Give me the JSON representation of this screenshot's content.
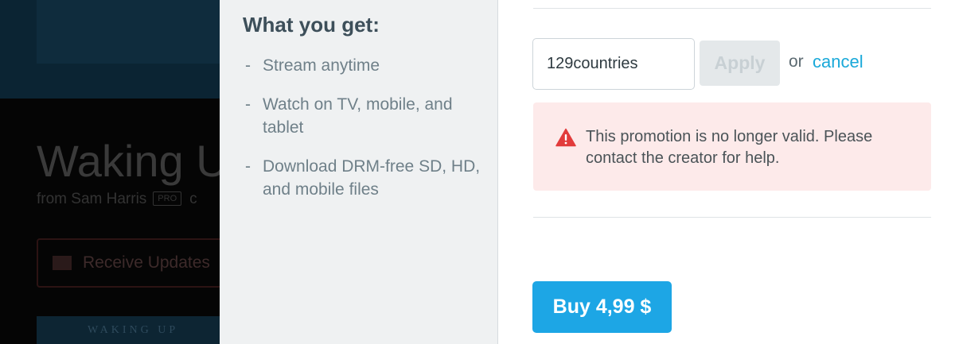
{
  "background": {
    "title": "Waking U",
    "byline_prefix": "from Sam Harris",
    "pro_badge": "PRO",
    "byline_suffix": "c",
    "receive_updates_label": "Receive Updates",
    "thumbnail_text": "WAKING UP"
  },
  "features": {
    "title": "What you get:",
    "dash": "-",
    "items": [
      "Stream anytime",
      "Watch on TV, mobile, and tablet",
      "Download DRM-free SD, HD, and mobile files"
    ]
  },
  "promo": {
    "code_value": "129countries",
    "apply_label": "Apply",
    "or_text": "or",
    "cancel_label": "cancel",
    "error_message": "This promotion is no longer valid. Please contact the creator for help."
  },
  "checkout": {
    "buy_label": "Buy 4,99 $"
  },
  "colors": {
    "accent": "#1da6e5",
    "link": "#1aa9d9",
    "error_bg": "#fdeaea",
    "error_icon": "#e23b3b"
  },
  "icons": {
    "warning": "warning-triangle-icon",
    "mail": "mail-icon"
  }
}
